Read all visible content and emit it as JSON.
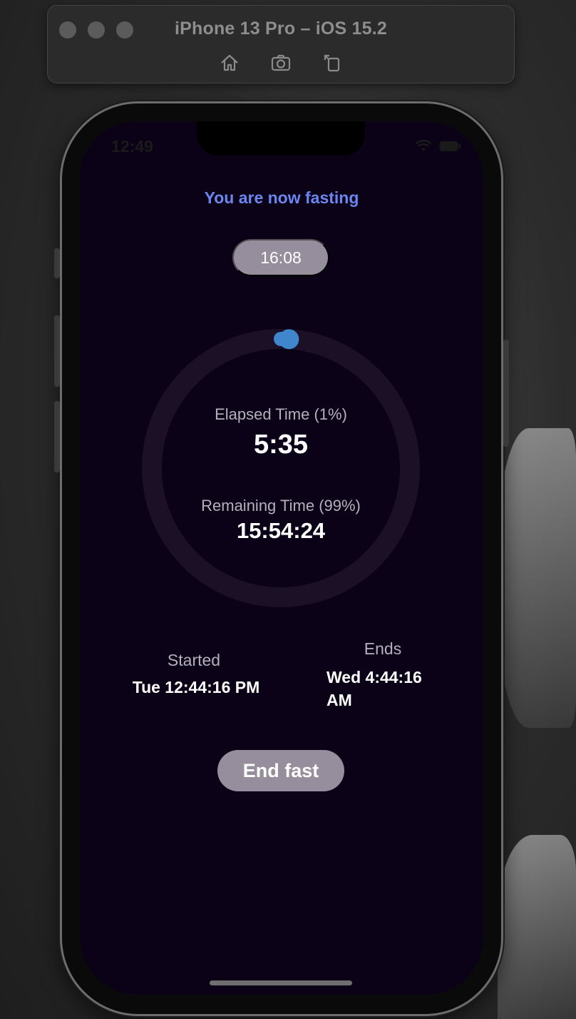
{
  "simulator": {
    "title": "iPhone 13 Pro – iOS 15.2",
    "tools": [
      "home-icon",
      "screenshot-camera-icon",
      "rotate-icon"
    ]
  },
  "status_bar": {
    "time": "12:49",
    "icons": [
      "wifi-icon",
      "battery-icon"
    ]
  },
  "app": {
    "heading": "You are now fasting",
    "goal": "16:08",
    "progress": {
      "elapsed_label": "Elapsed Time (1%)",
      "elapsed_value": "5:35",
      "remaining_label": "Remaining Time (99%)",
      "remaining_value": "15:54:24",
      "elapsed_fraction": 0.01
    },
    "started": {
      "label": "Started",
      "value": "Tue 12:44:16 PM"
    },
    "ends": {
      "label": "Ends",
      "value": "Wed 4:44:16 AM"
    },
    "end_button_label": "End fast"
  },
  "colors": {
    "screen_bg": "#0b0218",
    "accent_title": "#6c86f0",
    "ring_track": "#1c1026",
    "ring_progress": "#3f86cc",
    "pill_bg": "#968d9d"
  }
}
